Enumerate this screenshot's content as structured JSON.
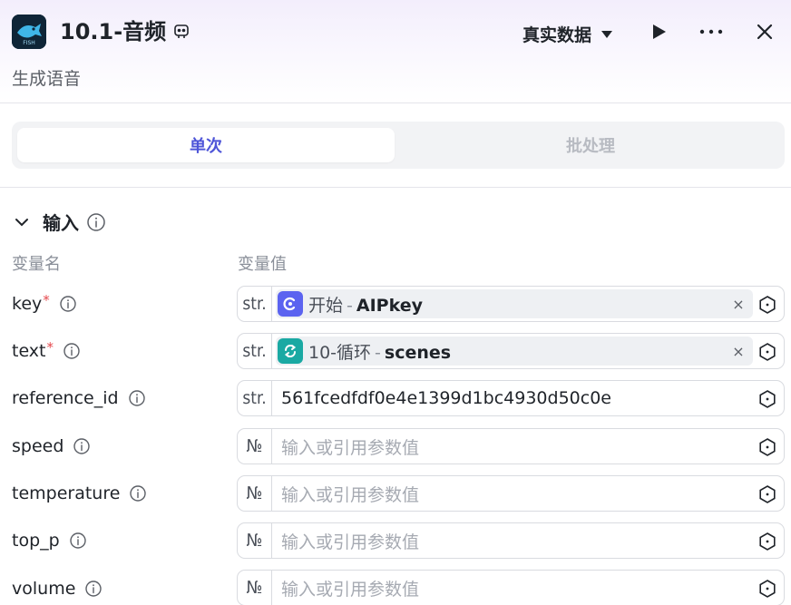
{
  "header": {
    "title": "10.1-音频",
    "subtitle": "生成语音",
    "data_mode": "真实数据",
    "app_icon_text": "FISH"
  },
  "tabs": [
    {
      "label": "单次",
      "active": true
    },
    {
      "label": "批处理",
      "active": false
    }
  ],
  "input_section": {
    "title": "输入",
    "col_name": "变量名",
    "col_value": "变量值"
  },
  "rows": [
    {
      "name": "key",
      "required": true,
      "type": "str.",
      "chip_source": "开始",
      "chip_var": "AIPkey",
      "chip_icon": "start-icon"
    },
    {
      "name": "text",
      "required": true,
      "type": "str.",
      "chip_source": "10-循环",
      "chip_var": "scenes",
      "chip_icon": "loop-icon"
    },
    {
      "name": "reference_id",
      "required": false,
      "type": "str.",
      "value": "561fcedfdf0e4e1399d1bc4930d50c0e"
    },
    {
      "name": "speed",
      "required": false,
      "type": "№",
      "placeholder": "输入或引用参数值"
    },
    {
      "name": "temperature",
      "required": false,
      "type": "№",
      "placeholder": "输入或引用参数值"
    },
    {
      "name": "top_p",
      "required": false,
      "type": "№",
      "placeholder": "输入或引用参数值"
    },
    {
      "name": "volume",
      "required": false,
      "type": "№",
      "placeholder": "输入或引用参数值"
    }
  ],
  "colors": {
    "accent": "#4e55d8",
    "start_chip": "#5b63f0",
    "loop_chip": "#1aa9a3",
    "required": "#e5484d"
  }
}
